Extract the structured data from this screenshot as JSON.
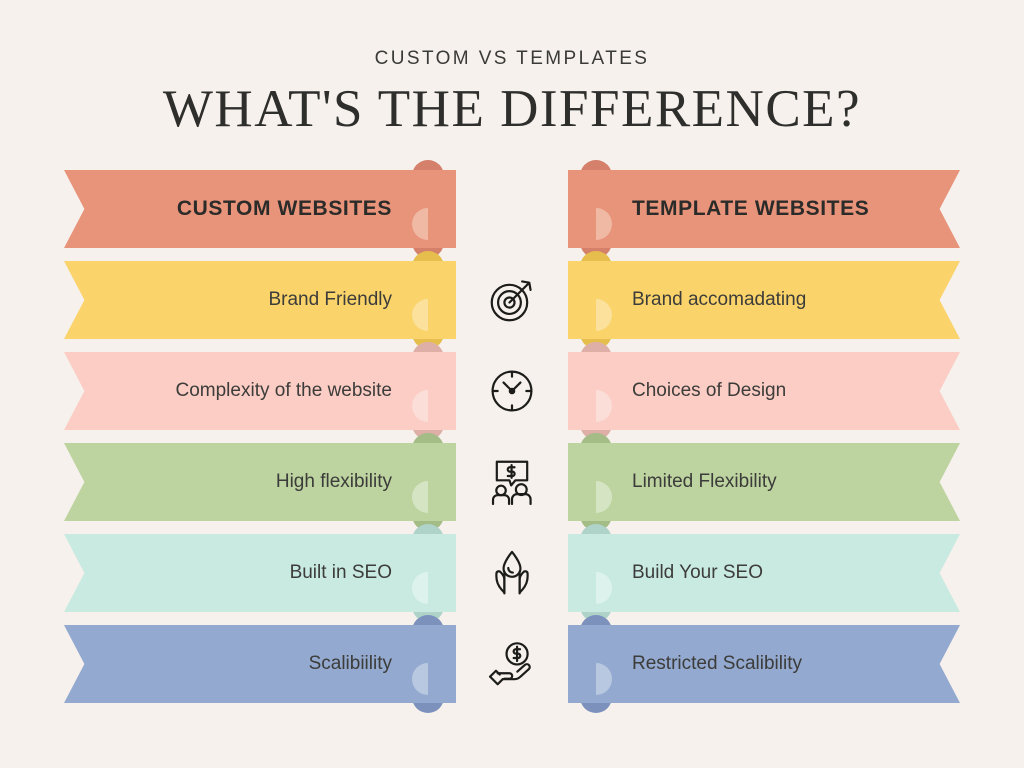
{
  "header": {
    "eyebrow": "CUSTOM VS TEMPLATES",
    "headline": "WHAT'S THE DIFFERENCE?"
  },
  "columns": {
    "left_title": "CUSTOM WEBSITES",
    "right_title": "TEMPLATE WEBSITES"
  },
  "palette": {
    "background": "#F6F1EC",
    "text": "#3C3C3A",
    "heading": "#2E2E2C"
  },
  "rows": [
    {
      "id": "header-row",
      "left": "CUSTOM WEBSITES",
      "right": "TEMPLATE WEBSITES",
      "icon": "",
      "fill": "#E8947B",
      "tab": "#D5806A",
      "dot_light": "#F0B9A4",
      "dot_dark": "#E8947B"
    },
    {
      "id": "brand-row",
      "left": "Brand Friendly",
      "right": "Brand accomadating",
      "icon": "target-icon",
      "fill": "#FAD46A",
      "tab": "#E5BE4D",
      "dot_light": "#FBE19B",
      "dot_dark": "#FAD46A"
    },
    {
      "id": "complexity-row",
      "left": "Complexity of the website",
      "right": "Choices of Design",
      "icon": "clock-icon",
      "fill": "#FBCDC4",
      "tab": "#DDAFA6",
      "dot_light": "#FBDED8",
      "dot_dark": "#FBCDC4"
    },
    {
      "id": "flexibility-row",
      "left": "High flexibility",
      "right": "Limited Flexibility",
      "icon": "negotiation-icon",
      "fill": "#BDD3A0",
      "tab": "#A4BC86",
      "dot_light": "#D5E4C3",
      "dot_dark": "#BDD3A0"
    },
    {
      "id": "seo-row",
      "left": "Built in SEO",
      "right": "Build Your SEO",
      "icon": "hands-drop-icon",
      "fill": "#C9EAE1",
      "tab": "#AFD2C9",
      "dot_light": "#DDF2EC",
      "dot_dark": "#C9EAE1"
    },
    {
      "id": "scalability-row",
      "left": "Scalibiility",
      "right": "Restricted Scalibility",
      "icon": "hand-coin-icon",
      "fill": "#93A9CF",
      "tab": "#7C92BC",
      "dot_light": "#B8C8E0",
      "dot_dark": "#93A9CF"
    }
  ],
  "icons": [
    {
      "name": "target-icon",
      "label": "Target with arrow"
    },
    {
      "name": "clock-icon",
      "label": "Clock"
    },
    {
      "name": "negotiation-icon",
      "label": "Two people with price bubble"
    },
    {
      "name": "hands-drop-icon",
      "label": "Hands holding a drop"
    },
    {
      "name": "hand-coin-icon",
      "label": "Hand holding a coin"
    }
  ]
}
